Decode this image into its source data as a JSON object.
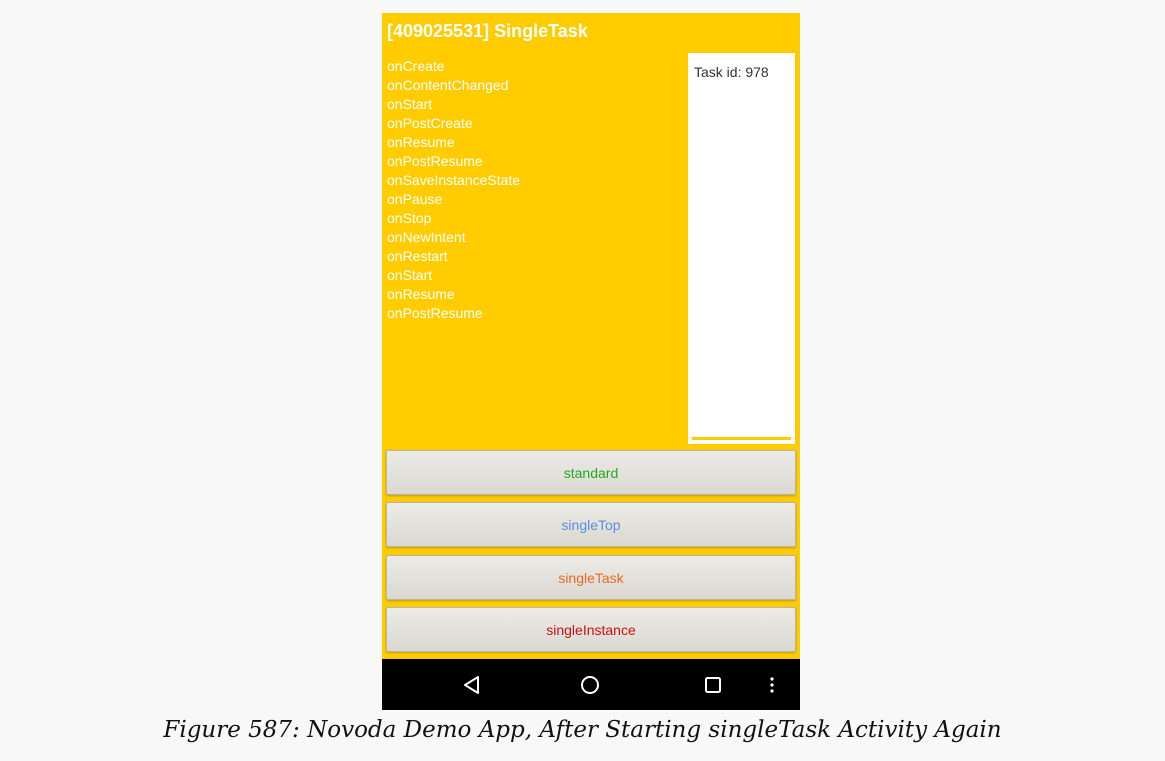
{
  "app": {
    "title": "[409025531] SingleTask"
  },
  "lifecycle_log": [
    "onCreate",
    "onContentChanged",
    "onStart",
    "onPostCreate",
    "onResume",
    "onPostResume",
    "onSaveInstanceState",
    "onPause",
    "onStop",
    "onNewIntent",
    "onRestart",
    "onStart",
    "onResume",
    "onPostResume"
  ],
  "task_panel": {
    "label": "Task id: 978"
  },
  "buttons": {
    "standard": "standard",
    "single_top": "singleTop",
    "single_task": "singleTask",
    "single_instance": "singleInstance"
  },
  "navbar": {
    "icons": [
      "back-icon",
      "home-icon",
      "recents-icon",
      "menu-icon"
    ]
  },
  "colors": {
    "background": "#ffcc00",
    "standard": "#22aa22",
    "single_top": "#5b8fdf",
    "single_task": "#ee6a20",
    "single_instance": "#cc1111"
  },
  "caption": "Figure 587: Novoda Demo App, After Starting singleTask Activity Again"
}
